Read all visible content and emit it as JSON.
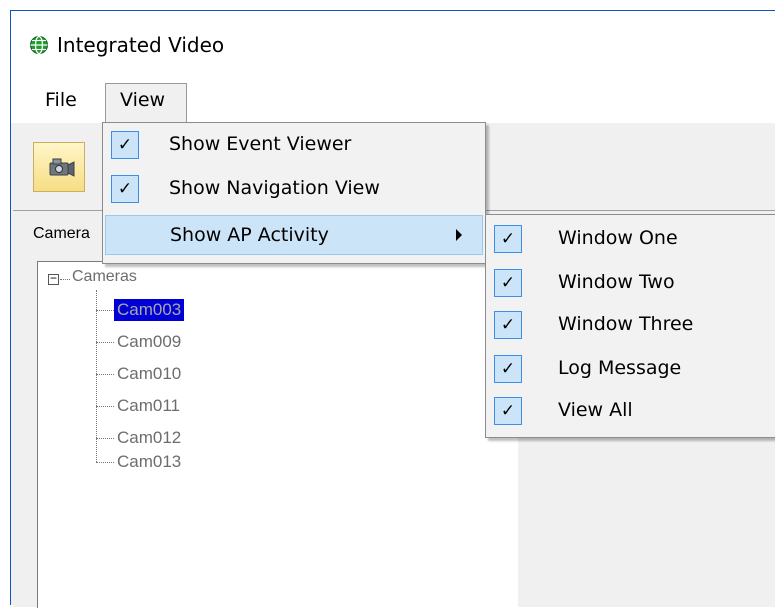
{
  "window": {
    "title": "Integrated Video"
  },
  "menubar": {
    "file": "File",
    "view": "View"
  },
  "panel": {
    "label": "Camera"
  },
  "tree": {
    "root": "Cameras",
    "items": [
      "Cam003",
      "Cam009",
      "Cam010",
      "Cam011",
      "Cam012",
      "Cam013"
    ],
    "selected": "Cam003"
  },
  "view_menu": {
    "items": [
      {
        "label": "Show Event Viewer",
        "checked": true
      },
      {
        "label": "Show Navigation View",
        "checked": true
      },
      {
        "label": "Show AP Activity",
        "checked": false,
        "submenu": true
      }
    ]
  },
  "ap_activity_menu": {
    "items": [
      {
        "label": "Window One",
        "checked": true
      },
      {
        "label": "Window Two",
        "checked": true
      },
      {
        "label": "Window Three",
        "checked": true
      },
      {
        "label": "Log Message",
        "checked": true
      },
      {
        "label": "View All",
        "checked": true
      }
    ]
  },
  "glyphs": {
    "check": "✓",
    "expand": "−"
  },
  "colors": {
    "highlight": "#cce4f7",
    "selection": "#0000d6",
    "title_border": "#0a59b8"
  }
}
